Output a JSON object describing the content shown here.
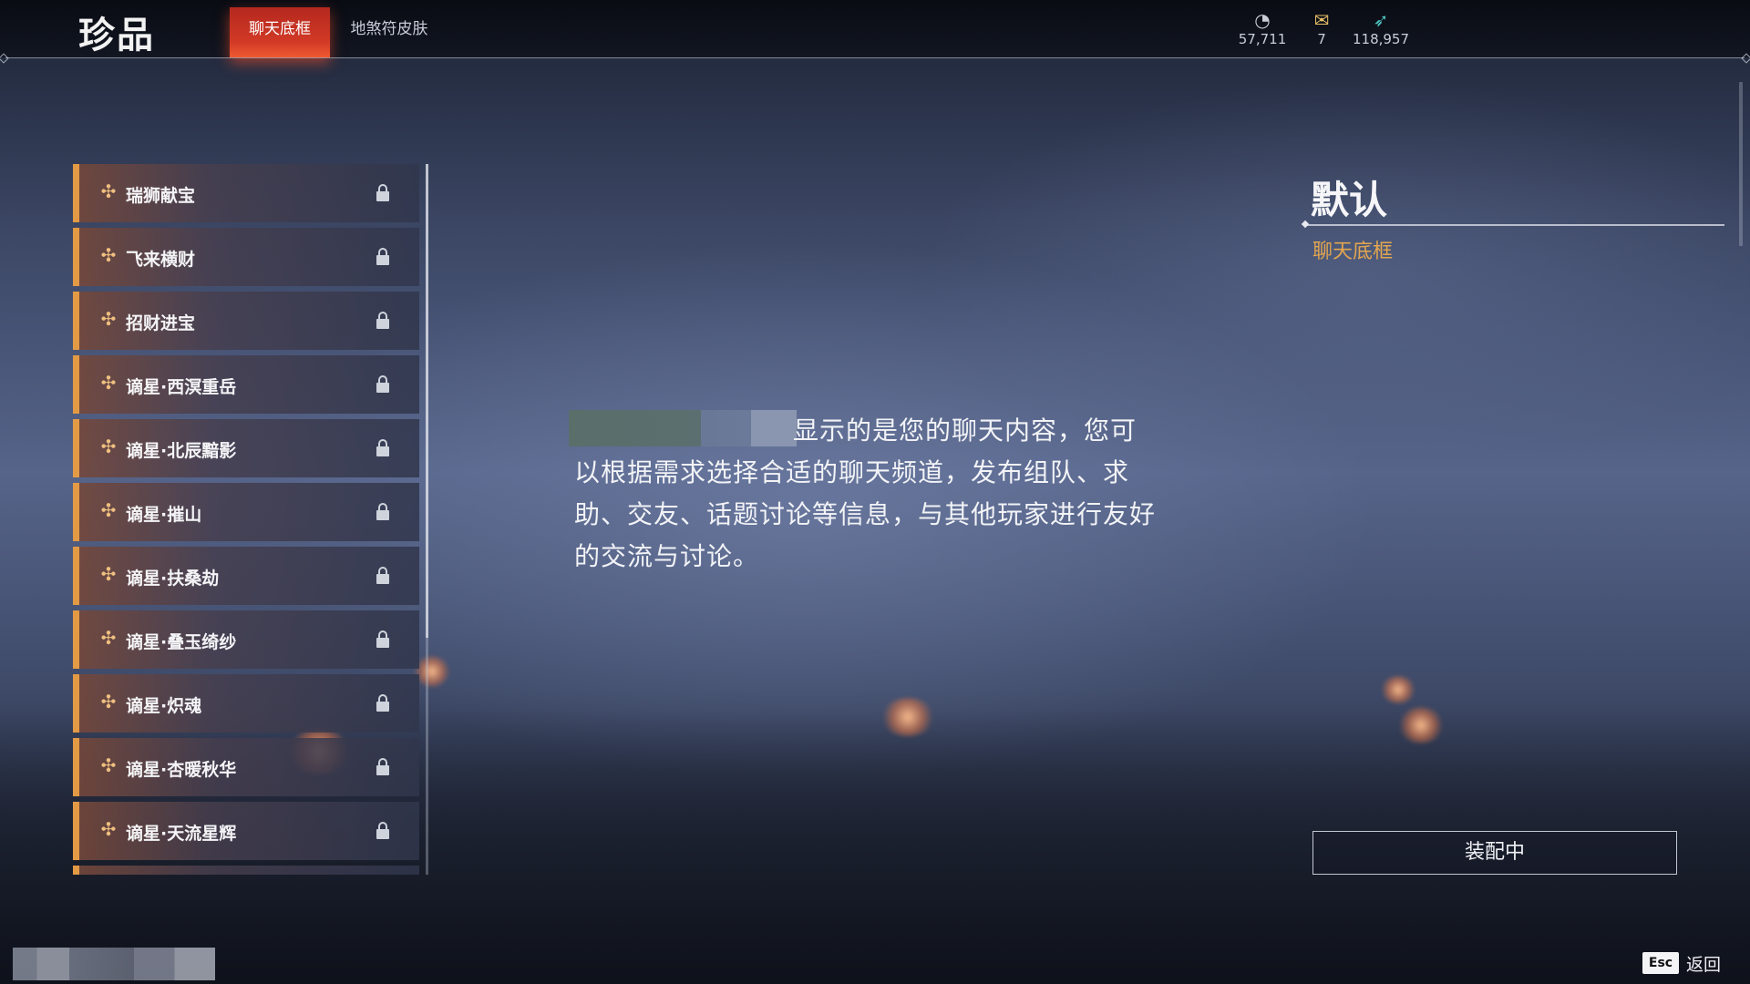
{
  "header": {
    "title": "珍品",
    "tabs": [
      {
        "label": "聊天底框",
        "active": true
      },
      {
        "label": "地煞符皮肤",
        "active": false
      }
    ],
    "currencies": [
      {
        "icon": "moon-coin-icon",
        "value": "57,711"
      },
      {
        "icon": "scroll-ticket-icon",
        "value": "7"
      },
      {
        "icon": "feather-icon",
        "value": "118,957"
      }
    ]
  },
  "list": {
    "items": [
      {
        "label": "瑞狮献宝",
        "locked": true
      },
      {
        "label": "飞来横财",
        "locked": true
      },
      {
        "label": "招财进宝",
        "locked": true
      },
      {
        "label": "谪星·西溟重岳",
        "locked": true
      },
      {
        "label": "谪星·北辰黯影",
        "locked": true
      },
      {
        "label": "谪星·摧山",
        "locked": true
      },
      {
        "label": "谪星·扶桑劫",
        "locked": true
      },
      {
        "label": "谪星·叠玉绮纱",
        "locked": true
      },
      {
        "label": "谪星·炽魂",
        "locked": true
      },
      {
        "label": "谪星·杏暖秋华",
        "locked": true
      },
      {
        "label": "谪星·天流星辉",
        "locked": true
      }
    ]
  },
  "preview": {
    "line1": "显示的是您的聊天内容，您可",
    "rest": "以根据需求选择合适的聊天频道，发布组队、求助、交友、话题讨论等信息，与其他玩家进行友好的交流与讨论。"
  },
  "detail": {
    "name": "默认",
    "category": "聊天底框",
    "button_label": "装配中"
  },
  "footer": {
    "esc_key": "Esc",
    "back_label": "返回"
  },
  "colors": {
    "accent": "#e39a45",
    "tab_active": "#d23a26",
    "category_text": "#e3a650"
  }
}
